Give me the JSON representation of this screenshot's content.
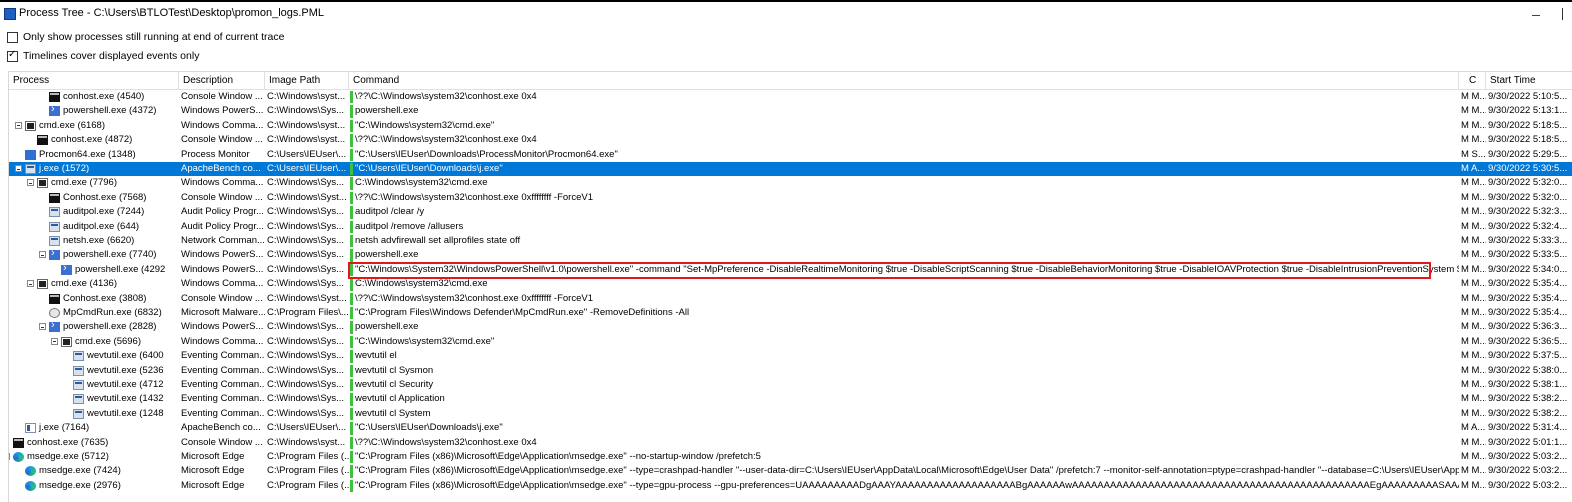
{
  "window": {
    "title": "Process Tree - C:\\Users\\BTLOTest\\Desktop\\promon_logs.PML"
  },
  "options": [
    {
      "label": "Only show processes still running at end of current trace",
      "checked": false
    },
    {
      "label": "Timelines cover displayed events only",
      "checked": true
    }
  ],
  "columns": {
    "process": "Process",
    "description": "Description",
    "image_path": "Image Path",
    "command": "Command",
    "c": "C",
    "start_time": "Start Time"
  },
  "rows": [
    {
      "name": "conhost.exe (4540)",
      "desc": "Console Window ...",
      "path": "C:\\Windows\\syst...",
      "cmd": "\\??\\C:\\Windows\\system32\\conhost.exe 0x4",
      "c": "M M...",
      "start": "9/30/2022 5:10:5..."
    },
    {
      "name": "powershell.exe (4372)",
      "desc": "Windows PowerS...",
      "path": "C:\\Windows\\Sys...",
      "cmd": "powershell.exe",
      "c": "M M...",
      "start": "9/30/2022 5:13:1..."
    },
    {
      "name": "cmd.exe (6168)",
      "desc": "Windows Comma...",
      "path": "C:\\Windows\\syst...",
      "cmd": "\"C:\\Windows\\system32\\cmd.exe\"",
      "c": "M M...",
      "start": "9/30/2022 5:18:5..."
    },
    {
      "name": "conhost.exe (4872)",
      "desc": "Console Window ...",
      "path": "C:\\Windows\\syst...",
      "cmd": "\\??\\C:\\Windows\\system32\\conhost.exe 0x4",
      "c": "M M...",
      "start": "9/30/2022 5:18:5..."
    },
    {
      "name": "Procmon64.exe (1348)",
      "desc": "Process Monitor",
      "path": "C:\\Users\\IEUser\\...",
      "cmd": "\"C:\\Users\\IEUser\\Downloads\\ProcessMonitor\\Procmon64.exe\"",
      "c": "M S...",
      "start": "9/30/2022 5:29:5..."
    },
    {
      "name": "j.exe (1572)",
      "desc": "ApacheBench co...",
      "path": "C:\\Users\\IEUser\\...",
      "cmd": "\"C:\\Users\\IEUser\\Downloads\\j.exe\"",
      "c": "M A...",
      "start": "9/30/2022 5:30:5..."
    },
    {
      "name": "cmd.exe (7796)",
      "desc": "Windows Comma...",
      "path": "C:\\Windows\\Sys...",
      "cmd": "C:\\Windows\\system32\\cmd.exe",
      "c": "M M...",
      "start": "9/30/2022 5:32:0..."
    },
    {
      "name": "Conhost.exe (7568)",
      "desc": "Console Window ...",
      "path": "C:\\Windows\\Syst...",
      "cmd": "\\??\\C:\\Windows\\system32\\conhost.exe 0xffffffff -ForceV1",
      "c": "M M...",
      "start": "9/30/2022 5:32:0..."
    },
    {
      "name": "auditpol.exe (7244)",
      "desc": "Audit Policy Progr...",
      "path": "C:\\Windows\\Sys...",
      "cmd": "auditpol  /clear /y",
      "c": "M M...",
      "start": "9/30/2022 5:32:3..."
    },
    {
      "name": "auditpol.exe (644)",
      "desc": "Audit Policy Progr...",
      "path": "C:\\Windows\\Sys...",
      "cmd": "auditpol  /remove /allusers",
      "c": "M M...",
      "start": "9/30/2022 5:32:4..."
    },
    {
      "name": "netsh.exe (6620)",
      "desc": "Network Comman...",
      "path": "C:\\Windows\\Sys...",
      "cmd": "netsh  advfirewall set allprofiles state off",
      "c": "M M...",
      "start": "9/30/2022 5:33:3..."
    },
    {
      "name": "powershell.exe (7740)",
      "desc": "Windows PowerS...",
      "path": "C:\\Windows\\Sys...",
      "cmd": "powershell.exe",
      "c": "M M...",
      "start": "9/30/2022 5:33:5..."
    },
    {
      "name": "powershell.exe (4292",
      "desc": "Windows PowerS...",
      "path": "C:\\Windows\\Sys...",
      "cmd": "\"C:\\Windows\\System32\\WindowsPowerShell\\v1.0\\powershell.exe\" -command \"Set-MpPreference -DisableRealtimeMonitoring $true -DisableScriptScanning $true -DisableBehaviorMonitoring $true -DisableIOAVProtection $true -DisableIntrusionPreventionSystem $true\"",
      "c": "M M...",
      "start": "9/30/2022 5:34:0..."
    },
    {
      "name": "cmd.exe (4136)",
      "desc": "Windows Comma...",
      "path": "C:\\Windows\\Sys...",
      "cmd": "C:\\Windows\\system32\\cmd.exe",
      "c": "M M...",
      "start": "9/30/2022 5:35:4..."
    },
    {
      "name": "Conhost.exe (3808)",
      "desc": "Console Window ...",
      "path": "C:\\Windows\\Syst...",
      "cmd": "\\??\\C:\\Windows\\system32\\conhost.exe 0xffffffff -ForceV1",
      "c": "M M...",
      "start": "9/30/2022 5:35:4..."
    },
    {
      "name": "MpCmdRun.exe (6832)",
      "desc": "Microsoft Malware...",
      "path": "C:\\Program Files\\...",
      "cmd": "\"C:\\Program Files\\Windows Defender\\MpCmdRun.exe\"  -RemoveDefinitions -All",
      "c": "M M...",
      "start": "9/30/2022 5:35:4..."
    },
    {
      "name": "powershell.exe (2828)",
      "desc": "Windows PowerS...",
      "path": "C:\\Windows\\Sys...",
      "cmd": "powershell.exe",
      "c": "M M...",
      "start": "9/30/2022 5:36:3..."
    },
    {
      "name": "cmd.exe (5696)",
      "desc": "Windows Comma...",
      "path": "C:\\Windows\\Sys...",
      "cmd": "\"C:\\Windows\\system32\\cmd.exe\"",
      "c": "M M...",
      "start": "9/30/2022 5:36:5..."
    },
    {
      "name": "wevtutil.exe (6400",
      "desc": "Eventing Comman...",
      "path": "C:\\Windows\\Sys...",
      "cmd": "wevtutil  el",
      "c": "M M...",
      "start": "9/30/2022 5:37:5..."
    },
    {
      "name": "wevtutil.exe (5236",
      "desc": "Eventing Comman...",
      "path": "C:\\Windows\\Sys...",
      "cmd": "wevtutil  cl Sysmon",
      "c": "M M...",
      "start": "9/30/2022 5:38:0..."
    },
    {
      "name": "wevtutil.exe (4712",
      "desc": "Eventing Comman...",
      "path": "C:\\Windows\\Sys...",
      "cmd": "wevtutil  cl Security",
      "c": "M M...",
      "start": "9/30/2022 5:38:1..."
    },
    {
      "name": "wevtutil.exe (1432",
      "desc": "Eventing Comman...",
      "path": "C:\\Windows\\Sys...",
      "cmd": "wevtutil  cl Application",
      "c": "M M...",
      "start": "9/30/2022 5:38:2..."
    },
    {
      "name": "wevtutil.exe (1248",
      "desc": "Eventing Comman...",
      "path": "C:\\Windows\\Sys...",
      "cmd": "wevtutil  cl System",
      "c": "M M...",
      "start": "9/30/2022 5:38:2..."
    },
    {
      "name": "j.exe (7164)",
      "desc": "ApacheBench co...",
      "path": "C:\\Users\\IEUser\\...",
      "cmd": "\"C:\\Users\\IEUser\\Downloads\\j.exe\"",
      "c": "M A...",
      "start": "9/30/2022 5:31:4..."
    },
    {
      "name": "conhost.exe (7635)",
      "desc": "Console Window ...",
      "path": "C:\\Windows\\syst...",
      "cmd": "\\??\\C:\\Windows\\system32\\conhost.exe 0x4",
      "c": "M M...",
      "start": "9/30/2022 5:01:1..."
    },
    {
      "name": "msedge.exe (5712)",
      "desc": "Microsoft Edge",
      "path": "C:\\Program Files (...",
      "cmd": "\"C:\\Program Files (x86)\\Microsoft\\Edge\\Application\\msedge.exe\" --no-startup-window /prefetch:5",
      "c": "M M...",
      "start": "9/30/2022 5:03:2..."
    },
    {
      "name": "msedge.exe (7424)",
      "desc": "Microsoft Edge",
      "path": "C:\\Program Files (...",
      "cmd": "\"C:\\Program Files (x86)\\Microsoft\\Edge\\Application\\msedge.exe\" --type=crashpad-handler \"--user-data-dir=C:\\Users\\IEUser\\AppData\\Local\\Microsoft\\Edge\\User Data\" /prefetch:7 --monitor-self-annotation=ptype=crashpad-handler \"--database=C:\\Users\\IEUser\\AppData\\...",
      "c": "M M...",
      "start": "9/30/2022 5:03:2..."
    },
    {
      "name": "msedge.exe (2976)",
      "desc": "Microsoft Edge",
      "path": "C:\\Program Files (...",
      "cmd": "\"C:\\Program Files (x86)\\Microsoft\\Edge\\Application\\msedge.exe\" --type=gpu-process --gpu-preferences=UAAAAAAAAADgAAAYAAAAAAAAAAAAAAAAAAABgAAAAAAwAAAAAAAAAAAAAAAAAAAAAAAAAAAAAAAAAAAAAAAAAAAAAAAEgAAAAAAAAASAAAAAAAAAAAYAAAAA...",
      "c": "M M...",
      "start": "9/30/2022 5:03:2..."
    }
  ]
}
